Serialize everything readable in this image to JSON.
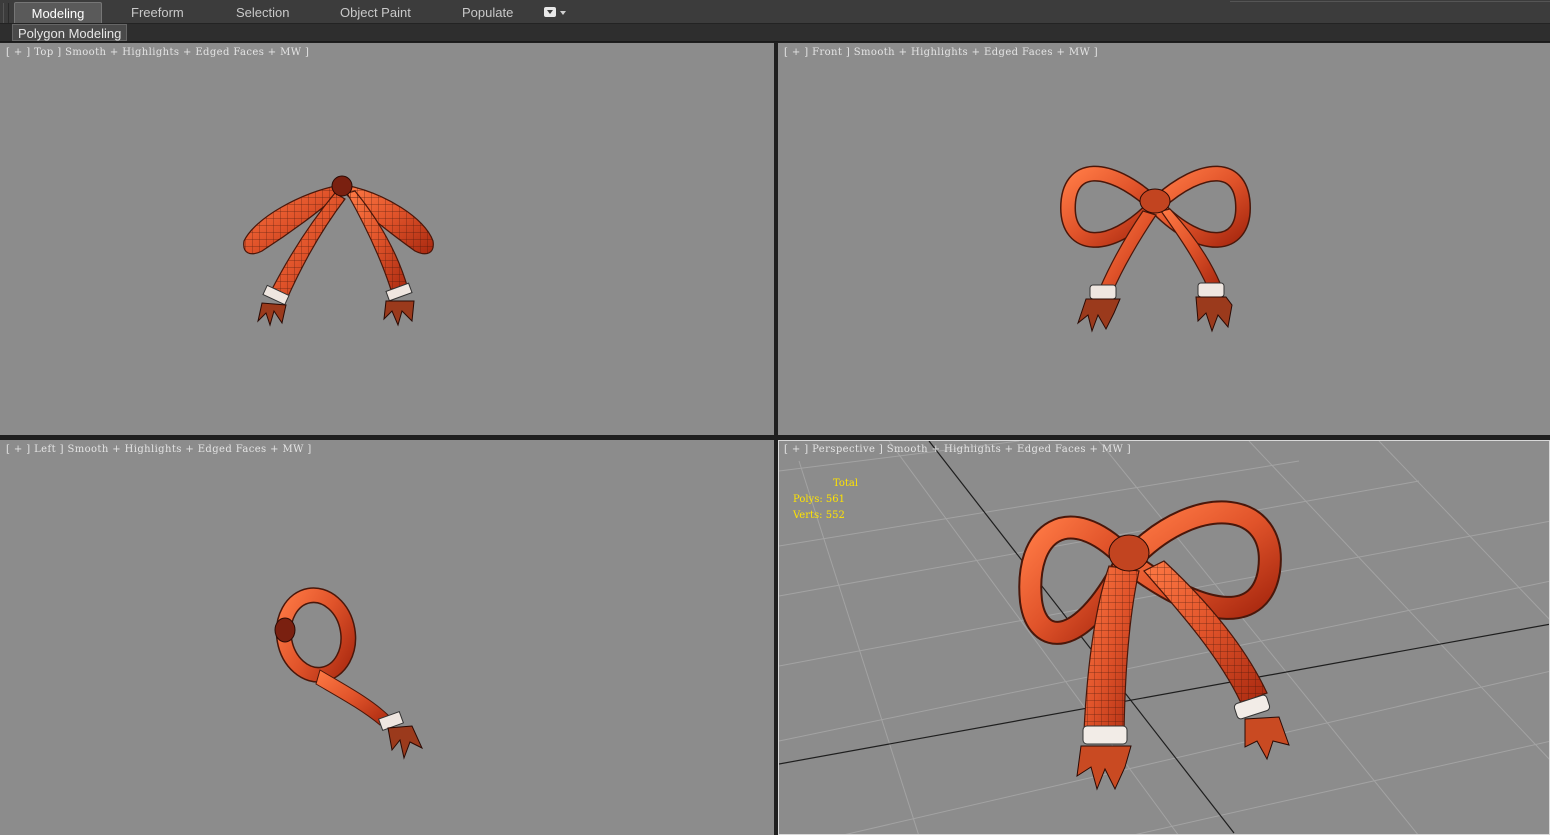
{
  "ribbon": {
    "tabs": [
      {
        "label": "Modeling",
        "active": true
      },
      {
        "label": "Freeform",
        "active": false
      },
      {
        "label": "Selection",
        "active": false
      },
      {
        "label": "Object Paint",
        "active": false
      },
      {
        "label": "Populate",
        "active": false
      }
    ],
    "panel_label": "Polygon Modeling"
  },
  "viewports": {
    "top": {
      "label": "[ + ] Top ] Smooth + Highlights + Edged Faces + MW ]"
    },
    "front": {
      "label": "[ + ] Front ] Smooth + Highlights + Edged Faces + MW ]"
    },
    "left": {
      "label": "[ + ] Left ] Smooth + Highlights + Edged Faces + MW ]"
    },
    "perspective": {
      "label": "[ + ] Perspective ] Smooth + Highlights + Edged Faces + MW ]",
      "stats": {
        "header": "Total",
        "polys_label": "Polys:",
        "polys_value": "561",
        "verts_label": "Verts:",
        "verts_value": "552"
      }
    }
  },
  "colors": {
    "viewport_bg": "#8c8c8c",
    "ribbon_red": "#e0532a",
    "ribbon_dark": "#a8280f",
    "stats_yellow": "#ffe400",
    "grid_line": "#a3a3a3"
  }
}
